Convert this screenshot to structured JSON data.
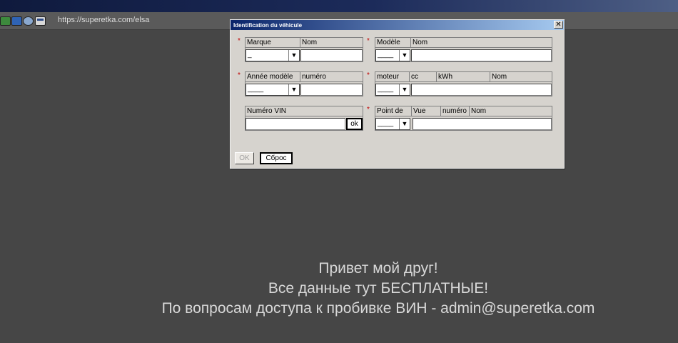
{
  "browser": {
    "url": "https://superetka.com/elsa",
    "toolbar_icons": [
      "car-green-icon",
      "car-blue-icon",
      "globe-icon",
      "window-icon"
    ]
  },
  "dialog": {
    "title": "Identification du véhicule",
    "close_glyph": "✕",
    "required_mark": "*",
    "marque": {
      "label": "Marque",
      "col2": "Nom",
      "select_value": "_"
    },
    "modele": {
      "label": "Modèle",
      "col2": "Nom",
      "select_value": "____"
    },
    "annee": {
      "label": "Année modèle",
      "col2": "numéro",
      "select_value": "____"
    },
    "moteur": {
      "label": "moteur",
      "col2": "cc",
      "col3": "kWh",
      "col4": "Nom",
      "select_value": "____"
    },
    "vin": {
      "label": "Numéro VIN",
      "ok_label": "ok"
    },
    "point": {
      "label": "Point de",
      "col2": "Vue",
      "col3": "numéro",
      "col4": "Nom",
      "select_value": "____"
    },
    "buttons": {
      "ok": "OK",
      "reset": "Сброс"
    }
  },
  "message": {
    "line1": "Привет мой друг!",
    "line2": "Все данные тут БЕСПЛАТНЫЕ!",
    "line3": "По вопросам доступа к пробивке ВИН - admin@superetka.com"
  },
  "colors": {
    "background": "#464646",
    "dialog_bg": "#d6d3ce",
    "title_gradient_start": "#0a246a",
    "title_gradient_end": "#a6caf0",
    "required": "#c00000"
  }
}
